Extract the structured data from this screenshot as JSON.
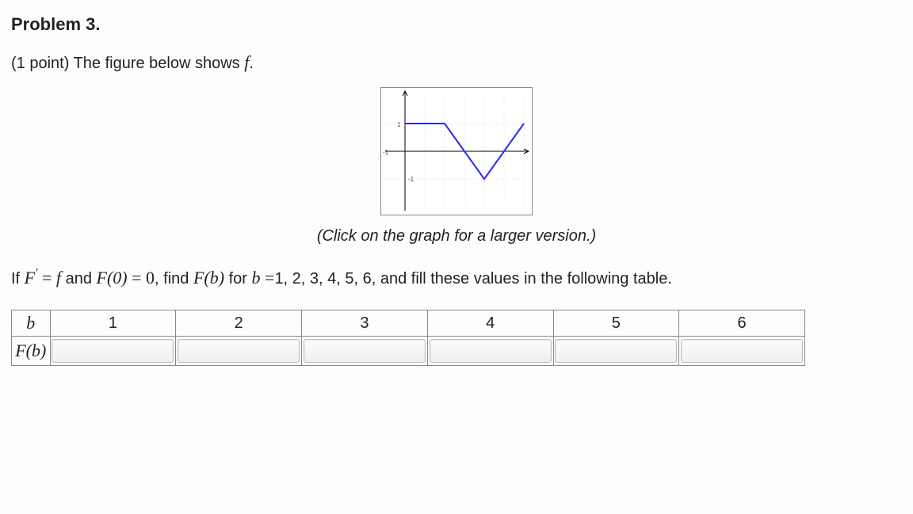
{
  "problem": {
    "title": "Problem 3.",
    "points_prefix": "(1 point) ",
    "prompt_text": "The figure below shows ",
    "prompt_tail": "."
  },
  "graph": {
    "caption": "(Click on the graph for a larger version.)",
    "y_tick_top": "1",
    "y_tick_bot": "-1",
    "x_tick_neg": "-1"
  },
  "question": {
    "seg_if": "If ",
    "F_prime": "F′",
    "seg_eq1": " = ",
    "f": "f",
    "seg_and": " and ",
    "F0": "F(0)",
    "seg_eq2": " = ",
    "zero": "0",
    "seg_find": ", find ",
    "Fb": "F(b)",
    "seg_for": " for ",
    "b": "b",
    "seg_eq3": " =",
    "values": "1, 2, 3, 4, 5, 6",
    "seg_tail": ", and fill these values in the following table."
  },
  "table": {
    "row1_header": "b",
    "row2_header": "F(b)",
    "columns": [
      "1",
      "2",
      "3",
      "4",
      "5",
      "6"
    ]
  },
  "chart_data": {
    "type": "line",
    "title": "",
    "xlabel": "",
    "ylabel": "",
    "xlim": [
      -1,
      6
    ],
    "ylim": [
      -2,
      2
    ],
    "series": [
      {
        "name": "f",
        "points": [
          {
            "x": 0,
            "y": 1
          },
          {
            "x": 2,
            "y": 1
          },
          {
            "x": 4,
            "y": -1
          },
          {
            "x": 6,
            "y": 1
          }
        ]
      }
    ]
  }
}
